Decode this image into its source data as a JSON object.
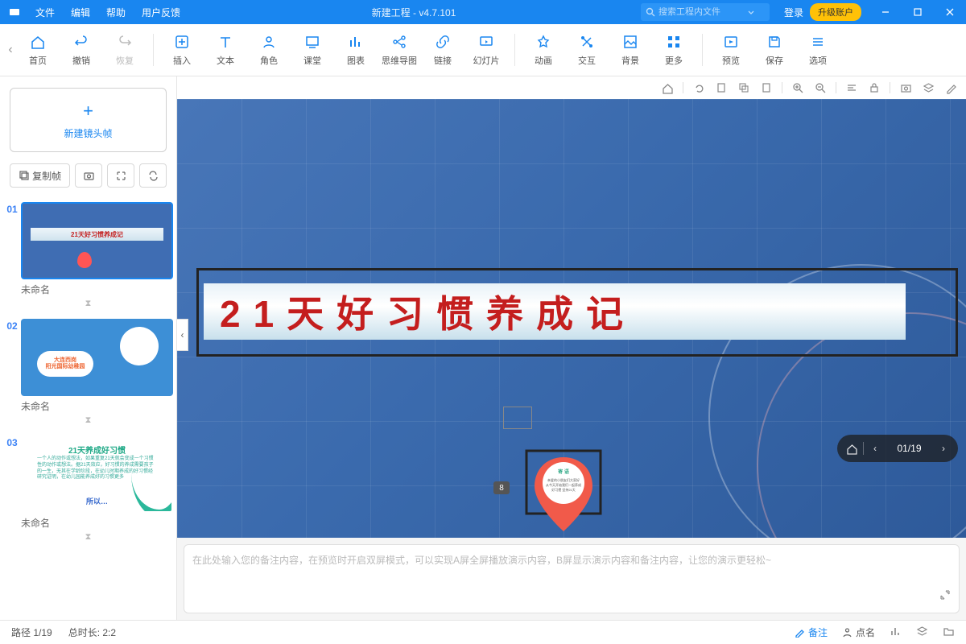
{
  "titlebar": {
    "menu": {
      "file": "文件",
      "edit": "编辑",
      "help": "帮助",
      "feedback": "用户反馈"
    },
    "title": "新建工程 - v4.7.101",
    "search_placeholder": "搜索工程内文件",
    "login": "登录",
    "upgrade": "升级账户"
  },
  "toolbar": {
    "home": "首页",
    "undo": "撤销",
    "redo": "恢复",
    "insert": "插入",
    "text": "文本",
    "role": "角色",
    "class": "课堂",
    "chart": "图表",
    "mindmap": "思维导图",
    "link": "链接",
    "slide": "幻灯片",
    "animation": "动画",
    "interact": "交互",
    "background": "背景",
    "more": "更多",
    "preview": "预览",
    "save": "保存",
    "options": "选项"
  },
  "sidebar": {
    "new_frame": "新建镜头帧",
    "copy_frame": "复制帧",
    "slides": [
      {
        "num": "01",
        "name": "未命名",
        "banner": "21天好习惯养成记"
      },
      {
        "num": "02",
        "name": "未命名",
        "cloud_l1": "大连西岗",
        "cloud_l2": "阳光国际幼稚园"
      },
      {
        "num": "03",
        "name": "未命名",
        "title": "21天养成好习惯",
        "body": "一个人的动作或想法，如果重复21天就会变成一个习惯性的动作或想法。据21天效应，好习惯的养成需要孩子的一生，无其在学龄阶段，在幼儿时期养成的好习惯经研究证明，在幼儿园能养成好的习惯更多",
        "foot": "所以…"
      }
    ],
    "timer_icon": "⧗"
  },
  "canvas": {
    "headline": "21天好习惯养成记",
    "pin_badge": "8",
    "nav": {
      "current": "01",
      "total": "19",
      "display": "01/19"
    }
  },
  "notes": {
    "placeholder": "在此处输入您的备注内容，在预览时开启双屏模式，可以实现A屏全屏播放演示内容，B屏显示演示内容和备注内容，让您的演示更轻松~"
  },
  "statusbar": {
    "path": "路径 1/19",
    "duration": "总时长: 2:2",
    "notes_btn": "备注",
    "like_btn": "点名"
  }
}
